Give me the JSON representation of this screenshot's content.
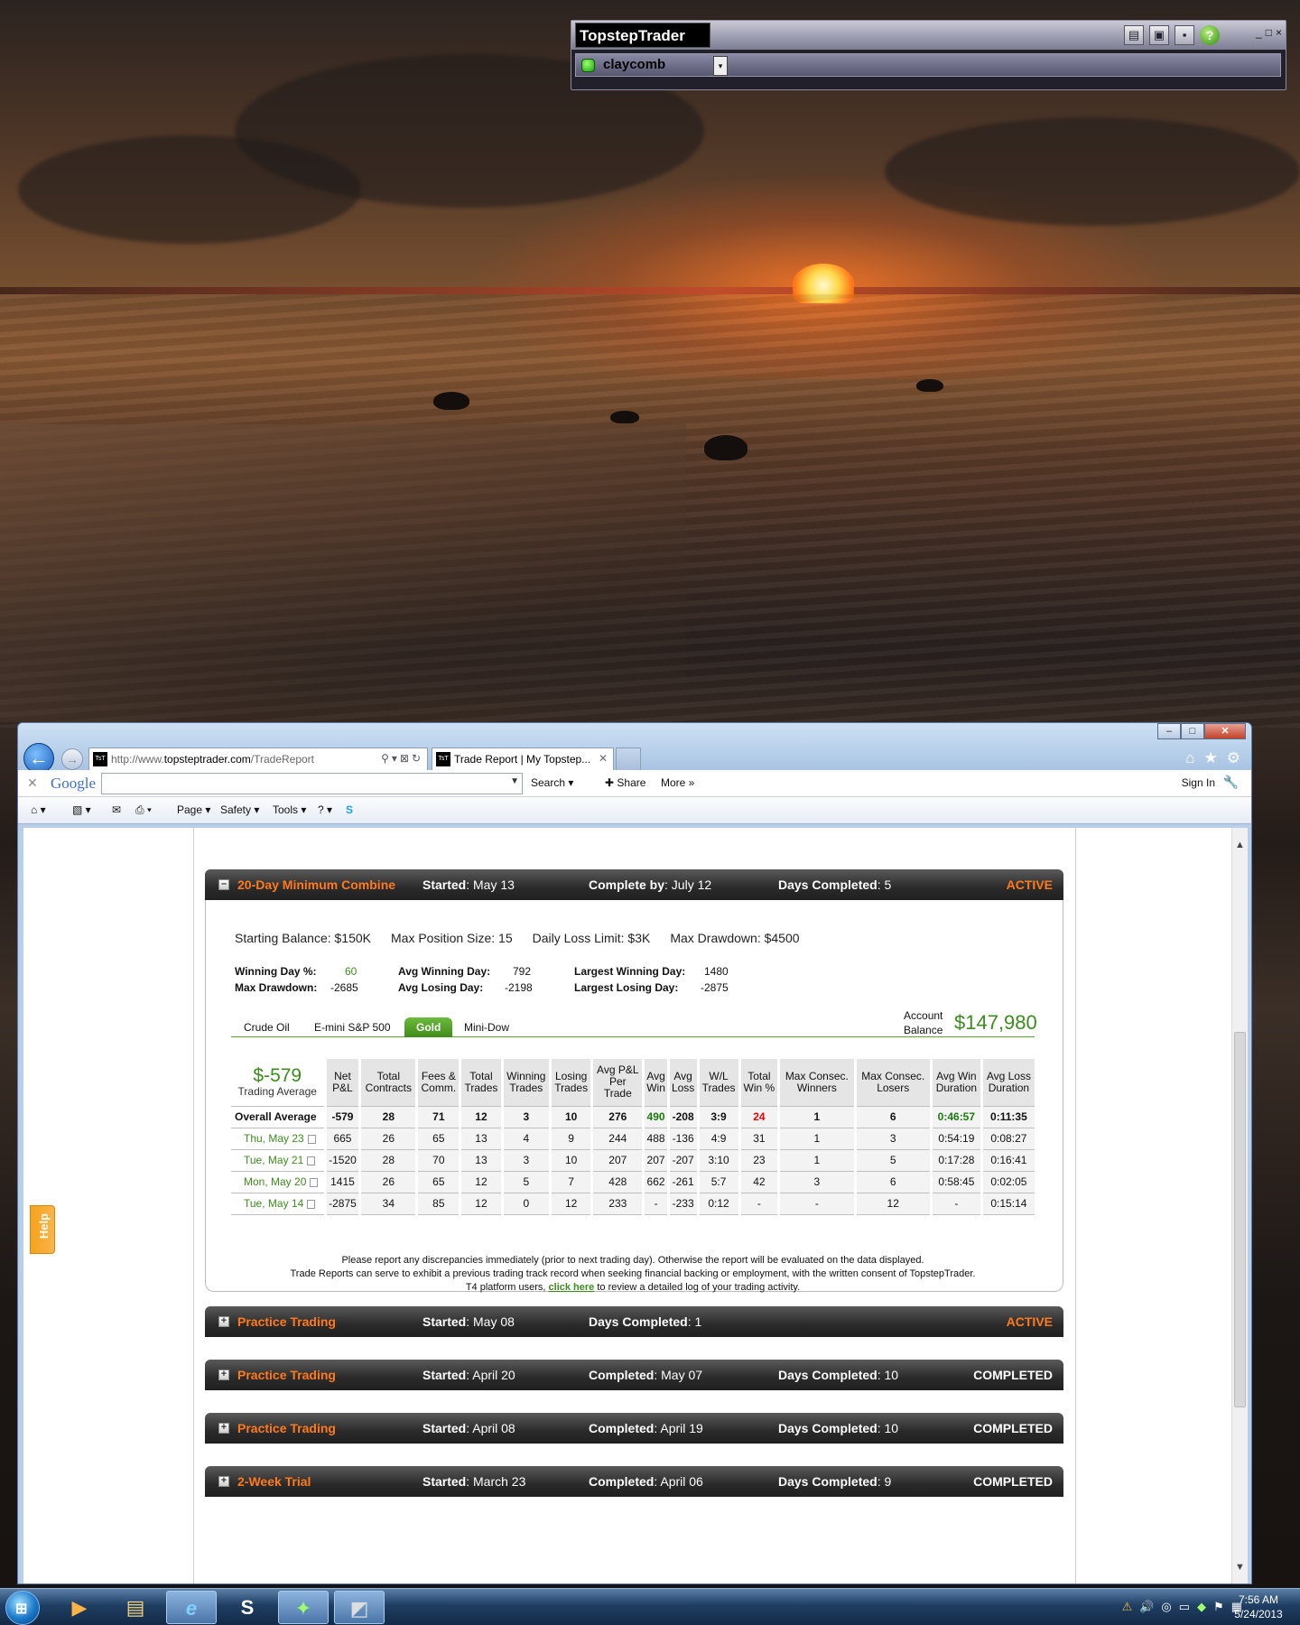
{
  "widget": {
    "brand": "TopstepTrader",
    "user": "claycomb",
    "icons": [
      "book-icon",
      "dropdown-arrow-icon",
      "network-icon",
      "save-icon",
      "help-icon"
    ],
    "help_glyph": "?",
    "window_buttons": [
      "_",
      "□",
      "×"
    ]
  },
  "browser": {
    "window_buttons": {
      "minimize": "–",
      "maximize": "□",
      "close": "✕"
    },
    "address_scheme": "http://www.",
    "address_host": "topsteptrader.com",
    "address_path": "/TradeReport",
    "address_tools": "⚲▾⊠↻",
    "tab_title": "Trade Report | My Topstep...",
    "tab_close": "✕",
    "back": "←",
    "forward": "→",
    "nav_icons": {
      "home": "⌂",
      "favorites": "★",
      "tools": "⚙"
    },
    "google_close": "✕",
    "google_logo": "Google",
    "google_search": "Search",
    "google_share": "Share",
    "google_more": "More »",
    "google_sign_in": "Sign In",
    "google_settings": "🔧",
    "cmd": {
      "page": "Page ▾",
      "safety": "Safety ▾",
      "tools": "Tools ▾",
      "help": "? ▾",
      "home_icon": "⌂ ▾",
      "feeds_icon": "▧ ▾",
      "mail_icon": "✉",
      "print_icon": "⎙ ▾"
    },
    "scroll_up": "▲",
    "scroll_down": "▼",
    "help_tab": "Help"
  },
  "combine": {
    "toggle": "–",
    "name": "20-Day Minimum Combine",
    "started_label": "Started",
    "started": ": May 13",
    "complete_label": "Complete by",
    "complete": ": July 12",
    "days_label": "Days Completed",
    "days": ": 5",
    "status": "ACTIVE",
    "summary": [
      "Starting Balance: $150K",
      "Max Position Size: 15",
      "Daily Loss Limit: $3K",
      "Max Drawdown: $4500"
    ],
    "stats": {
      "winning_day_label": "Winning Day %:",
      "winning_day": "60",
      "max_drawdown_label": "Max Drawdown:",
      "max_drawdown": "-2685",
      "avg_winning_day_label": "Avg Winning Day:",
      "avg_winning_day": "792",
      "avg_losing_day_label": "Avg Losing Day:",
      "avg_losing_day": "-2198",
      "largest_winning_day_label": "Largest Winning Day:",
      "largest_winning_day": "1480",
      "largest_losing_day_label": "Largest Losing Day:",
      "largest_losing_day": "-2875"
    },
    "tabs": [
      "Crude Oil",
      "E-mini S&P 500",
      "Gold",
      "Mini-Dow"
    ],
    "selected_tab": "Gold",
    "account_label_1": "Account",
    "account_label_2": "Balance",
    "account_balance": "$147,980",
    "trading_avg_value": "$-579",
    "trading_avg_label": "Trading Average",
    "columns": [
      [
        "Net",
        "P&L"
      ],
      [
        "Total",
        "Contracts"
      ],
      [
        "Fees &",
        "Comm."
      ],
      [
        "Total",
        "Trades"
      ],
      [
        "Winning",
        "Trades"
      ],
      [
        "Losing",
        "Trades"
      ],
      [
        "Avg P&L",
        "Per",
        "Trade"
      ],
      [
        "Avg",
        "Win"
      ],
      [
        "Avg",
        "Loss"
      ],
      [
        "W/L",
        "Trades"
      ],
      [
        "Total",
        "Win %"
      ],
      [
        "Max Consec.",
        "Winners"
      ],
      [
        "Max Consec.",
        "Losers"
      ],
      [
        "Avg Win",
        "Duration"
      ],
      [
        "Avg Loss",
        "Duration"
      ]
    ],
    "overall": {
      "label": "Overall Average",
      "cells": [
        "-579",
        "28",
        "71",
        "12",
        "3",
        "10",
        "276",
        "490",
        "-208",
        "3:9",
        "24",
        "1",
        "6",
        "0:46:57",
        "0:11:35"
      ]
    },
    "rows": [
      {
        "date": "Thu, May 23",
        "cells": [
          "665",
          "26",
          "65",
          "13",
          "4",
          "9",
          "244",
          "488",
          "-136",
          "4:9",
          "31",
          "1",
          "3",
          "0:54:19",
          "0:08:27"
        ]
      },
      {
        "date": "Tue, May 21",
        "cells": [
          "-1520",
          "28",
          "70",
          "13",
          "3",
          "10",
          "207",
          "207",
          "-207",
          "3:10",
          "23",
          "1",
          "5",
          "0:17:28",
          "0:16:41"
        ]
      },
      {
        "date": "Mon, May 20",
        "cells": [
          "1415",
          "26",
          "65",
          "12",
          "5",
          "7",
          "428",
          "662",
          "-261",
          "5:7",
          "42",
          "3",
          "6",
          "0:58:45",
          "0:02:05"
        ]
      },
      {
        "date": "Tue, May 14",
        "cells": [
          "-2875",
          "34",
          "85",
          "12",
          "0",
          "12",
          "233",
          "-",
          "-233",
          "0:12",
          "-",
          "-",
          "12",
          "-",
          "0:15:14"
        ]
      }
    ],
    "note1": "Please report any discrepancies immediately (prior to next trading day). Otherwise the report will be evaluated on the data displayed.",
    "note2": "Trade Reports can serve to exhibit a previous trading track record when seeking financial backing or employment, with the written consent of TopstepTrader.",
    "note3_pre": "T4 platform users, ",
    "note3_link": "click here",
    "note3_post": " to review a detailed log of your trading activity."
  },
  "panels": [
    {
      "toggle": "+",
      "name": "Practice Trading",
      "started_label": "Started",
      "started": ": May 08",
      "mid_label": "Days Completed",
      "mid": ": 1",
      "right_label": "",
      "right": "",
      "status": "ACTIVE"
    },
    {
      "toggle": "+",
      "name": "Practice Trading",
      "started_label": "Started",
      "started": ": April 20",
      "mid_label": "Completed",
      "mid": ": May 07",
      "right_label": "Days Completed",
      "right": ": 10",
      "status": "COMPLETED"
    },
    {
      "toggle": "+",
      "name": "Practice Trading",
      "started_label": "Started",
      "started": ": April 08",
      "mid_label": "Completed",
      "mid": ": April 19",
      "right_label": "Days Completed",
      "right": ": 10",
      "status": "COMPLETED"
    },
    {
      "toggle": "+",
      "name": "2-Week Trial",
      "started_label": "Started",
      "started": ": March 23",
      "mid_label": "Completed",
      "mid": ": April 06",
      "right_label": "Days Completed",
      "right": ": 9",
      "status": "COMPLETED"
    }
  ],
  "taskbar": {
    "start": "⊞",
    "apps": [
      {
        "name": "media-player-icon",
        "glyph": "▶"
      },
      {
        "name": "file-explorer-icon",
        "glyph": "▤"
      },
      {
        "name": "internet-explorer-icon",
        "glyph": "e"
      },
      {
        "name": "skype-icon",
        "glyph": "S"
      },
      {
        "name": "trading-app-icon",
        "glyph": "✦"
      },
      {
        "name": "t4-app-icon",
        "glyph": "◩"
      }
    ],
    "tray": [
      "⚠",
      "🔊",
      "◎",
      "▭",
      "◆",
      "⚑",
      "▦"
    ],
    "time": "7:56 AM",
    "date": "5/24/2013"
  }
}
